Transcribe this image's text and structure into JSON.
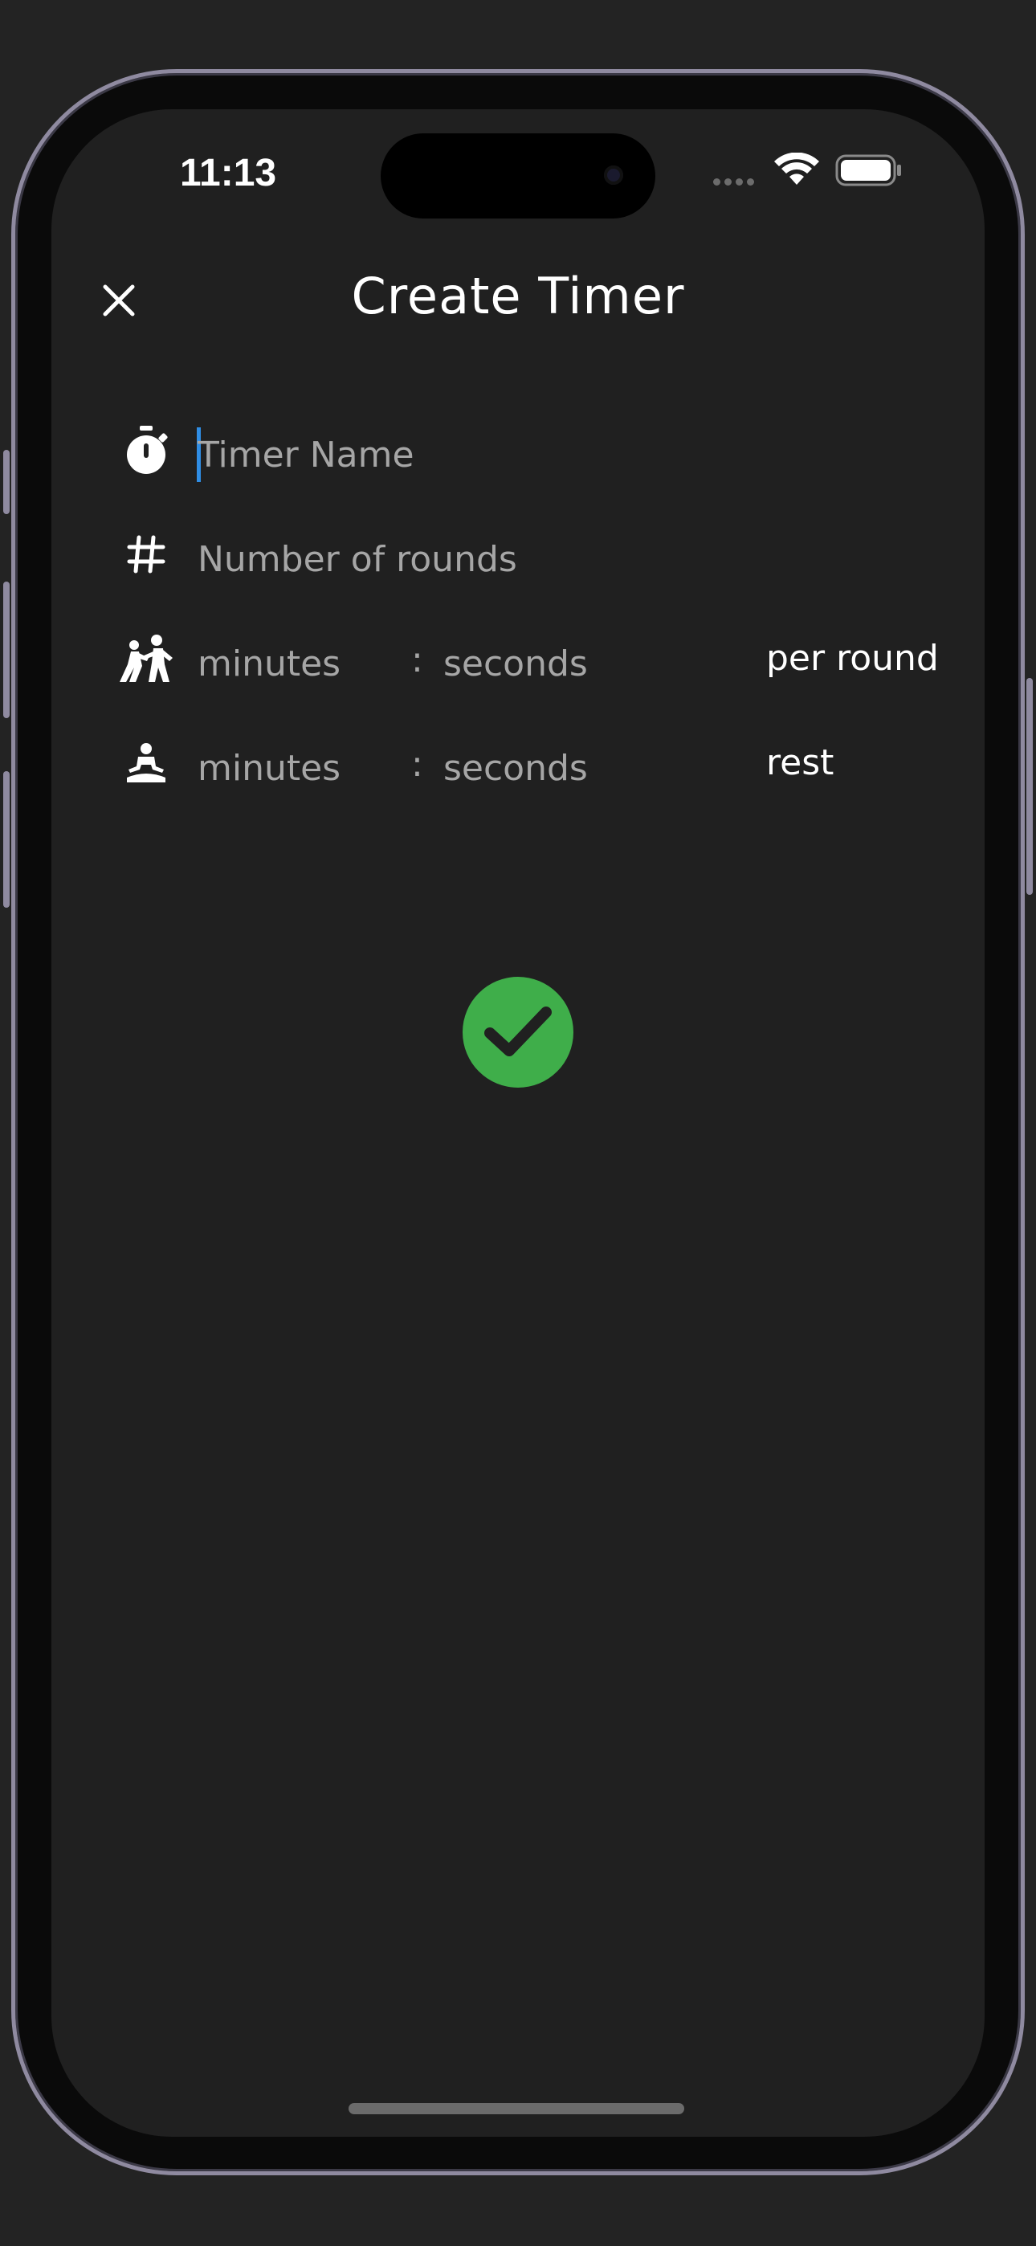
{
  "status_bar": {
    "time": "11:13"
  },
  "header": {
    "title": "Create Timer",
    "close_icon": "close-icon"
  },
  "form": {
    "timer_name": {
      "icon": "stopwatch-icon",
      "placeholder": "Timer Name",
      "value": ""
    },
    "rounds": {
      "icon": "hash-icon",
      "placeholder": "Number of rounds",
      "value": ""
    },
    "round_duration": {
      "icon": "sparring-icon",
      "minutes_placeholder": "minutes",
      "separator": ":",
      "seconds_placeholder": "seconds",
      "suffix": "per round"
    },
    "rest_duration": {
      "icon": "meditation-icon",
      "minutes_placeholder": "minutes",
      "separator": ":",
      "seconds_placeholder": "seconds",
      "suffix": "rest"
    }
  },
  "confirm": {
    "icon": "check-icon",
    "color": "#3fae4a"
  },
  "colors": {
    "background": "#202020",
    "text": "#ffffff",
    "placeholder": "#a6a6a6",
    "caret": "#2f8de4"
  }
}
